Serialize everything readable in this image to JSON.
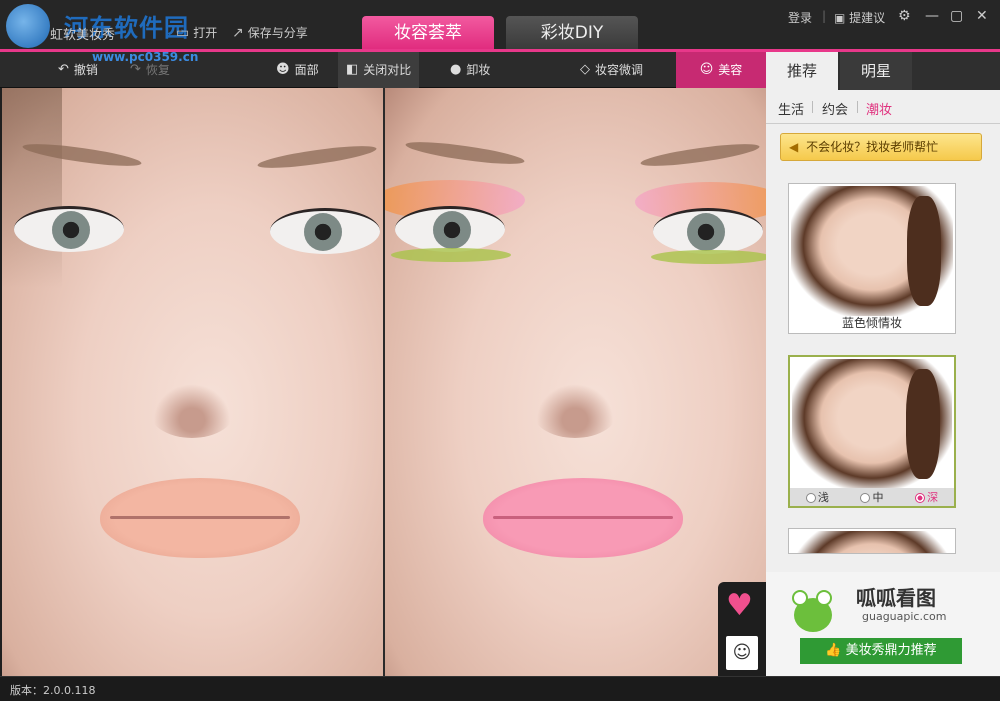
{
  "titlebar": {
    "watermark": "河东软件园",
    "watermark_url": "www.pc0359.cn",
    "app_name": "虹软美妆秀",
    "open_label": "打开",
    "save_share_label": "保存与分享",
    "tab_recommended": "妆容荟萃",
    "tab_diy": "彩妆DIY",
    "login_label": "登录",
    "feedback_label": "提建议"
  },
  "toolbar": {
    "undo_label": "撤销",
    "redo_label": "恢复",
    "face_label": "面部",
    "compare_label": "关闭对比",
    "remove_label": "卸妆",
    "adjust_label": "妆容微调",
    "beauty_label": "美容"
  },
  "panel": {
    "tab_recommend": "推荐",
    "tab_star": "明星",
    "subtabs": [
      "生活",
      "约会",
      "潮妆"
    ],
    "help_label": "不会化妆？找妆老师帮忙",
    "card1_label": "蓝色倾情妆",
    "intensity": [
      "浅",
      "中",
      "深"
    ],
    "ad_title": "呱呱看图",
    "ad_url": "guaguapic.com",
    "ad_button": "美妆秀鼎力推荐"
  },
  "status": {
    "version": "版本：2.0.0.118"
  },
  "colors": {
    "accent": "#e8388a",
    "dark": "#262626",
    "green": "#2f9a34"
  }
}
